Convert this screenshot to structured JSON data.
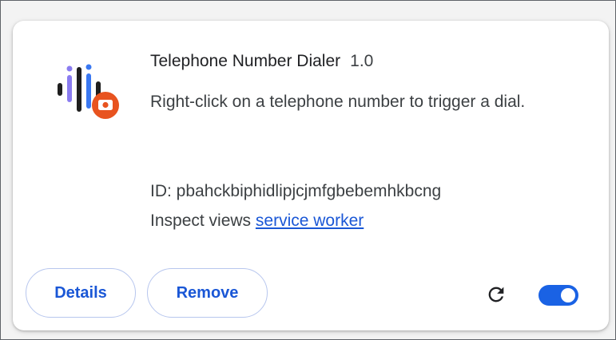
{
  "extension": {
    "name": "Telephone Number Dialer",
    "version": "1.0",
    "description": "Right-click on a telephone number to trigger a dial.",
    "id_text": "ID: pbahckbiphidlipjcjmfgbebemhkbcng",
    "inspect_label": "Inspect views",
    "inspect_link": "service worker",
    "enabled": true
  },
  "buttons": {
    "details": "Details",
    "remove": "Remove"
  },
  "icons": {
    "extension": "telephone-dialer-icon",
    "reload": "reload-icon",
    "toggle": "enable-toggle"
  },
  "colors": {
    "accent": "#1a57d6",
    "toggle_on": "#1a62e4",
    "icon_badge": "#e8531f",
    "icon_bars_dark": "#1e1e1e",
    "icon_bars_purple": "#8a7cf0",
    "icon_bars_blue": "#3a78f2"
  }
}
